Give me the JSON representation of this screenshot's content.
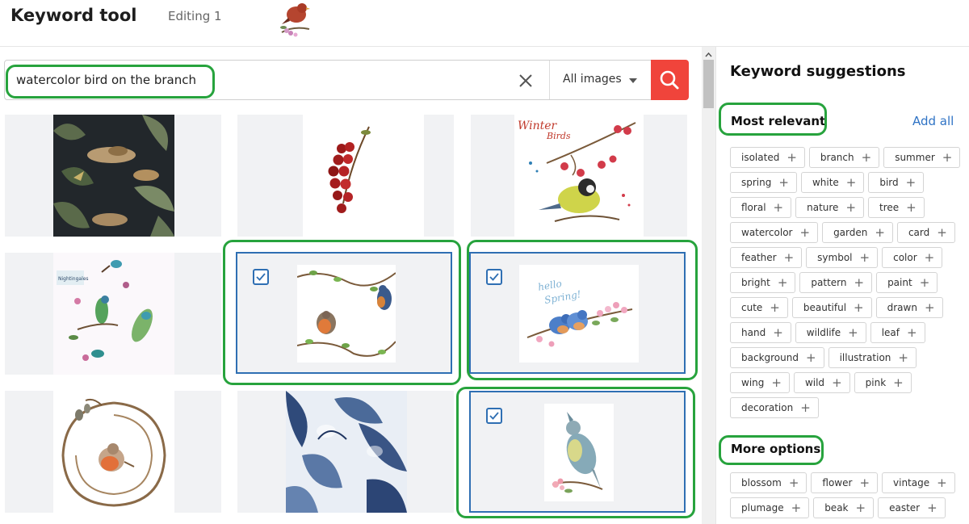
{
  "header": {
    "title": "Keyword tool",
    "editing": "Editing 1"
  },
  "search": {
    "query": "watercolor bird on the branch",
    "filter": "All images"
  },
  "grid": [
    {
      "selected": false,
      "art": "jungle"
    },
    {
      "selected": false,
      "art": "cherry"
    },
    {
      "selected": false,
      "art": "winter"
    },
    {
      "selected": false,
      "art": "hummingbirds"
    },
    {
      "selected": true,
      "art": "robin-pattern"
    },
    {
      "selected": true,
      "art": "bluebird"
    },
    {
      "selected": false,
      "art": "wreath"
    },
    {
      "selected": false,
      "art": "blue-pattern"
    },
    {
      "selected": true,
      "art": "titmouse"
    }
  ],
  "sidebar": {
    "title": "Keyword suggestions",
    "most_relevant_label": "Most relevant",
    "add_all": "Add all",
    "more_options_label": "More options",
    "most_relevant": [
      "isolated",
      "branch",
      "summer",
      "spring",
      "white",
      "bird",
      "floral",
      "nature",
      "tree",
      "watercolor",
      "garden",
      "card",
      "feather",
      "symbol",
      "color",
      "bright",
      "pattern",
      "paint",
      "cute",
      "beautiful",
      "drawn",
      "hand",
      "wildlife",
      "leaf",
      "background",
      "illustration",
      "wing",
      "wild",
      "pink",
      "decoration"
    ],
    "more_options": [
      "blossom",
      "flower",
      "vintage",
      "plumage",
      "beak",
      "easter"
    ]
  },
  "colors": {
    "accent": "#f0443b",
    "selection": "#2f6fb3",
    "highlight": "#27a33d",
    "link": "#2f73c5"
  }
}
